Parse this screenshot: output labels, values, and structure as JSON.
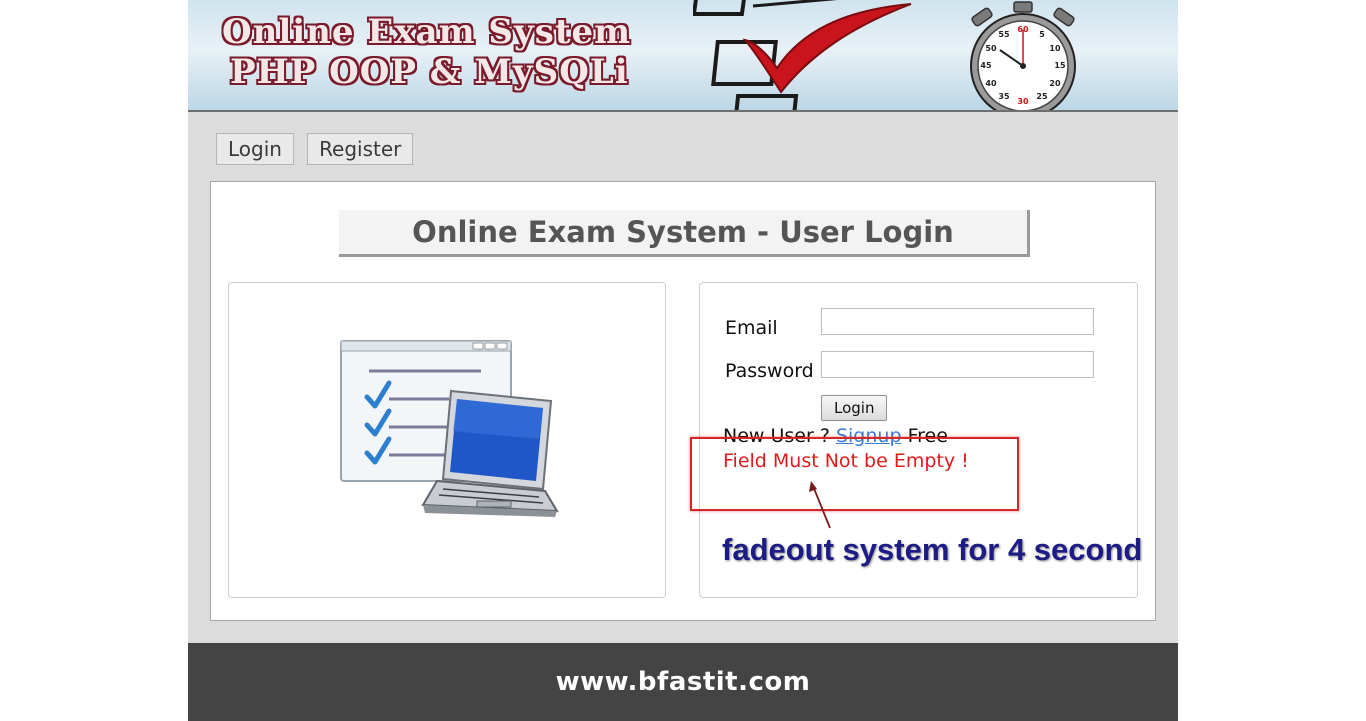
{
  "banner": {
    "title_line1": "Online Exam System",
    "title_line2": "PHP OOP & MySQLi",
    "stopwatch_numbers": [
      "60",
      "5",
      "10",
      "15",
      "20",
      "25",
      "30",
      "35",
      "40",
      "45",
      "50",
      "55"
    ]
  },
  "nav": {
    "items": [
      {
        "label": "Login"
      },
      {
        "label": "Register"
      }
    ]
  },
  "page": {
    "heading": "Online Exam System - User Login"
  },
  "form": {
    "email_label": "Email",
    "email_value": "",
    "password_label": "Password",
    "password_value": "",
    "submit_label": "Login",
    "signup_prefix": "New User ?",
    "signup_link": "Signup",
    "signup_suffix": "Free",
    "error_message": "Field Must Not be Empty !"
  },
  "annotation": {
    "text": "fadeout system for 4 second",
    "color": "#1c1c84",
    "box_color": "#d42828"
  },
  "footer": {
    "text": "www.bfastit.com"
  },
  "colors": {
    "page_bg": "#dcdcdc",
    "footer_bg": "#444444",
    "error": "#e01b1b",
    "link": "#3a7fd5"
  },
  "icons": [
    "checklist-icon",
    "checkmark-icon",
    "stopwatch-icon",
    "laptop-icon"
  ]
}
